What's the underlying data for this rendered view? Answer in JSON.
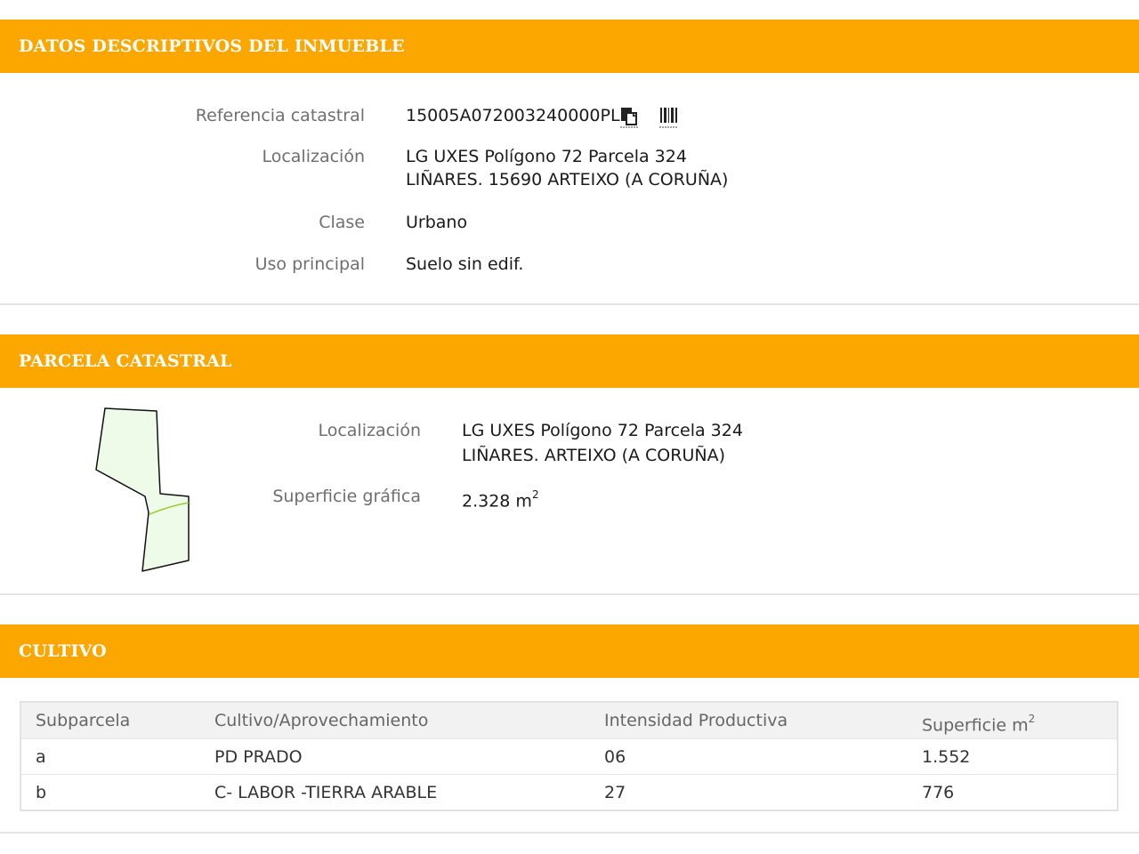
{
  "sections": {
    "descriptive": {
      "title": "DATOS DESCRIPTIVOS DEL INMUEBLE"
    },
    "parcel": {
      "title": "PARCELA CATASTRAL"
    },
    "crop": {
      "title": "CULTIVO"
    }
  },
  "property": {
    "ref_label": "Referencia catastral",
    "ref_value": "15005A072003240000PL",
    "loc_label": "Localización",
    "loc_line1": "LG UXES Polígono 72 Parcela 324",
    "loc_line2": "LIÑARES. 15690 ARTEIXO (A CORUÑA)",
    "class_label": "Clase",
    "class_value": "Urbano",
    "use_label": "Uso principal",
    "use_value": "Suelo sin edif."
  },
  "parcel": {
    "loc_label": "Localización",
    "loc_line1": "LG UXES Polígono 72 Parcela 324",
    "loc_line2": "LIÑARES. ARTEIXO (A CORUÑA)",
    "surface_label": "Superficie gráfica",
    "surface_value": "2.328 m",
    "surface_sup": "2"
  },
  "crop_table": {
    "headers": {
      "subparcel": "Subparcela",
      "crop": "Cultivo/Aprovechamiento",
      "intensity": "Intensidad Productiva",
      "surface": "Superficie m",
      "surface_sup": "2"
    },
    "rows": [
      {
        "subparcel": "a",
        "crop": "PD PRADO",
        "intensity": "06",
        "surface": "1.552"
      },
      {
        "subparcel": "b",
        "crop": "C- LABOR -TIERRA ARABLE",
        "intensity": "27",
        "surface": "776"
      }
    ]
  },
  "icons": {
    "copy": "copy-icon",
    "barcode": "barcode-icon"
  },
  "colors": {
    "header_bg": "#fca600",
    "parcel_fill": "#eefbe9",
    "parcel_divider": "#9acd32"
  }
}
